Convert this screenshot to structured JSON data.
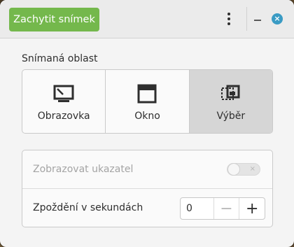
{
  "header": {
    "capture_label": "Zachytit snímek",
    "menu_icon": "vertical-dots-icon",
    "minimize_icon": "minimize-icon",
    "close_icon": "close-icon",
    "close_glyph": "×"
  },
  "area": {
    "title": "Snímaná oblast",
    "options": [
      {
        "label": "Obrazovka",
        "icon": "monitor-icon",
        "selected": false
      },
      {
        "label": "Okno",
        "icon": "window-icon",
        "selected": false
      },
      {
        "label": "Výběr",
        "icon": "selection-icon",
        "selected": true
      }
    ]
  },
  "settings": {
    "show_pointer_label": "Zobrazovat ukazatel",
    "show_pointer_enabled": false,
    "toggle_off_glyph": "×",
    "delay_label": "Zpoždění v sekundách",
    "delay_value": "0",
    "decrement_glyph": "−",
    "increment_glyph": "+"
  },
  "colors": {
    "accent_green": "#74b84c",
    "close_blue": "#3a9bc4",
    "selected_bg": "#d6d6d6"
  }
}
